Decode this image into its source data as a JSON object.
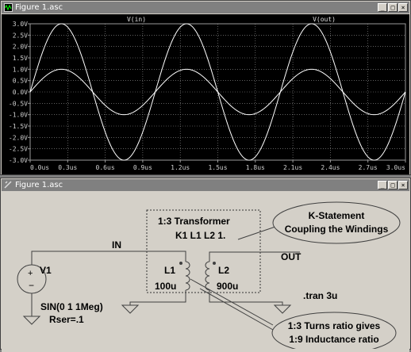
{
  "waveform_window": {
    "title": "Figure 1.asc",
    "trace_labels": [
      "V(in)",
      "V(out)"
    ],
    "y_ticks": [
      "3.0V",
      "2.5V",
      "2.0V",
      "1.5V",
      "1.0V",
      "0.5V",
      "0.0V",
      "-0.5V",
      "-1.0V",
      "-1.5V",
      "-2.0V",
      "-2.5V",
      "-3.0V"
    ],
    "x_ticks": [
      "0.0us",
      "0.3us",
      "0.6us",
      "0.9us",
      "1.2us",
      "1.5us",
      "1.8us",
      "2.1us",
      "2.4us",
      "2.7us",
      "3.0us"
    ]
  },
  "schematic_window": {
    "title": "Figure 1.asc",
    "net_in": "IN",
    "net_out": "OUT",
    "source_name": "V1",
    "source_value": "SIN(0 1 1Meg)",
    "source_rser": "Rser=.1",
    "box_title": "1:3 Transformer",
    "k_statement": "K1 L1 L2 1.",
    "l1_name": "L1",
    "l1_value": "100u",
    "l2_name": "L2",
    "l2_value": "900u",
    "tran": ".tran 3u",
    "callout_top": [
      "K-Statement",
      "Coupling the Windings"
    ],
    "callout_bottom": [
      "1:3 Turns ratio gives",
      "1:9 Inductance ratio"
    ]
  },
  "window_buttons": {
    "minimize": "_",
    "restore": "□",
    "close": "×"
  },
  "colors": {
    "trace": "#ffffff",
    "plot_bg": "#000000",
    "grid": "#9a9a9a",
    "schematic_bg": "#d4d0c8",
    "wire": "#404040",
    "titlebar": "#808080"
  },
  "chart_data": {
    "type": "line",
    "x_unit": "us",
    "xlim": [
      0,
      3.0
    ],
    "ylim": [
      -3.0,
      3.0
    ],
    "grid": true,
    "series": [
      {
        "name": "V(in)",
        "amplitude": 1.0,
        "frequency_mhz": 1.0,
        "points_x": [
          0,
          0.25,
          0.5,
          0.75,
          1.0,
          1.25,
          1.5,
          1.75,
          2.0,
          2.25,
          2.5,
          2.75,
          3.0
        ],
        "points_y": [
          0,
          1,
          0,
          -1,
          0,
          1,
          0,
          -1,
          0,
          1,
          0,
          -1,
          0
        ]
      },
      {
        "name": "V(out)",
        "amplitude": 3.0,
        "frequency_mhz": 1.0,
        "points_x": [
          0,
          0.25,
          0.5,
          0.75,
          1.0,
          1.25,
          1.5,
          1.75,
          2.0,
          2.25,
          2.5,
          2.75,
          3.0
        ],
        "points_y": [
          0,
          3,
          0,
          -3,
          0,
          3,
          0,
          -3,
          0,
          3,
          0,
          -3,
          0
        ]
      }
    ]
  }
}
